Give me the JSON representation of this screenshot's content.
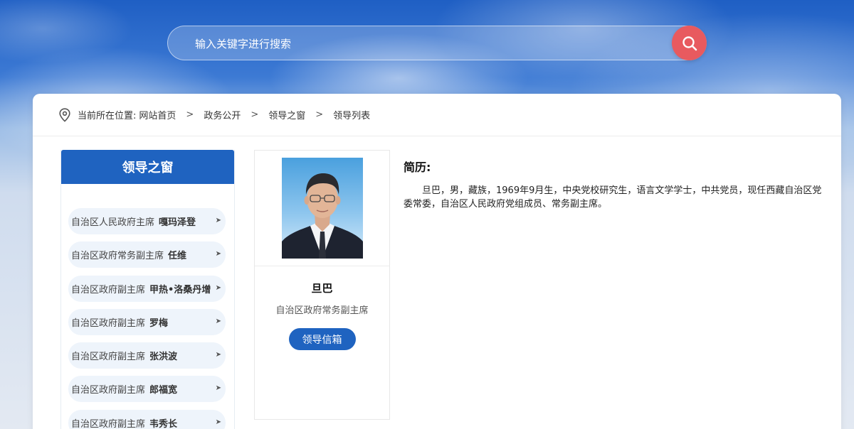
{
  "search": {
    "placeholder": "输入关键字进行搜索"
  },
  "breadcrumb": {
    "prefix": "当前所在位置:",
    "items": [
      "网站首页",
      "政务公开",
      "领导之窗",
      "领导列表"
    ],
    "separator": ">"
  },
  "sidebar": {
    "title": "领导之窗",
    "items": [
      {
        "role": "自治区人民政府主席",
        "name": "嘎玛泽登"
      },
      {
        "role": "自治区政府常务副主席",
        "name": "任维"
      },
      {
        "role": "自治区政府副主席",
        "name": "甲热•洛桑丹增"
      },
      {
        "role": "自治区政府副主席",
        "name": "罗梅"
      },
      {
        "role": "自治区政府副主席",
        "name": "张洪波"
      },
      {
        "role": "自治区政府副主席",
        "name": "郎福宽"
      },
      {
        "role": "自治区政府副主席",
        "name": "韦秀长"
      }
    ]
  },
  "profile": {
    "name": "旦巴",
    "title": "自治区政府常务副主席",
    "mailbox_label": "领导信箱"
  },
  "bio": {
    "heading": "简历:",
    "text": "旦巴，男，藏族，1969年9月生，中央党校研究生，语言文学学士，中共党员，现任西藏自治区党委常委，自治区人民政府党组成员、常务副主席。"
  },
  "colors": {
    "primary": "#1f63c0",
    "search_button": "#e85a5f",
    "list_item_bg": "#eef4fb"
  }
}
